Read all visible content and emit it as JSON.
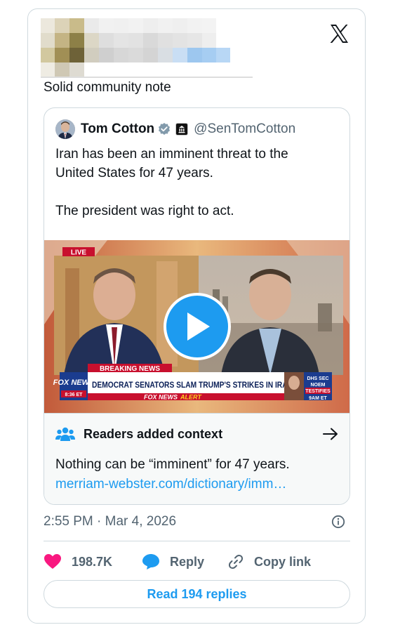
{
  "post": {
    "text": "Solid community note",
    "timestamp": "2:55 PM · Mar 4, 2026"
  },
  "quoted_post": {
    "author_name": "Tom Cotton",
    "handle": "@SenTomCotton",
    "line1": "Iran has been an imminent threat to the",
    "line2": "United States for 47 years.",
    "line3": "The president was right to act.",
    "video": {
      "live_badge": "LIVE",
      "breaking_label": "BREAKING NEWS",
      "network_logo": "FOX NEWS",
      "network_time": "8:36 ET",
      "chyron": "DEMOCRAT SENATORS SLAM TRUMP'S STRIKES IN IRAN",
      "ticker_brand": "FOX NEWS",
      "ticker_alert": "ALERT",
      "promo_line1": "DHS SEC",
      "promo_line2": "NOEM",
      "promo_line3": "TESTIFIES",
      "promo_time": "9AM ET"
    }
  },
  "community_note": {
    "title": "Readers added context",
    "text": "Nothing can be “imminent” for 47 years.",
    "link": "merriam-webster.com/dictionary/imm…"
  },
  "actions": {
    "likes": "198.7K",
    "reply": "Reply",
    "copy_link": "Copy link"
  },
  "read_replies": "Read 194 replies",
  "colors": {
    "accent": "#1d9bf0",
    "like": "#f91880",
    "text": "#0f1419",
    "muted": "#536471",
    "border": "#cfd9de"
  }
}
